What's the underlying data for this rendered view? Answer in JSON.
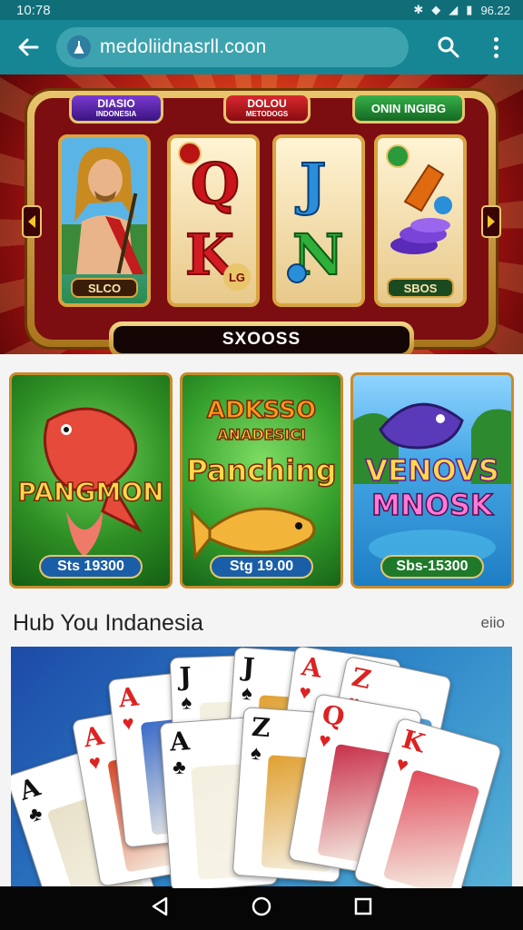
{
  "status_bar": {
    "time": "10:78",
    "battery": "96.22",
    "colors": {
      "background": "#0f6e78"
    }
  },
  "toolbar": {
    "url": "medoliidnasrll.coon",
    "back_icon": "back-arrow-icon",
    "search_icon": "search-icon",
    "menu_icon": "more-vert-icon",
    "colors": {
      "background": "#168694",
      "url_bar": "#3da3af"
    }
  },
  "banner": {
    "pill_left_line1": "DIASIO",
    "pill_left_line2": "INDONESIA",
    "pill_mid_line1": "DOLOU",
    "pill_mid_line2": "METODOGS",
    "pill_right": "ONIN INGIBG",
    "reels": [
      {
        "label": "SLCO"
      },
      {
        "letter_top": "Q",
        "letter_bottom": "K",
        "badge": "LG"
      },
      {
        "letter_top": "J",
        "letter_bottom": "N"
      },
      {
        "label": "SBOS"
      }
    ],
    "bottom_text": "SXOOSS"
  },
  "games": [
    {
      "title": "PANGMON",
      "price": "Sts 19300"
    },
    {
      "title_top": "ADKSSO",
      "title_mid": "ANADESICI",
      "title": "Panching",
      "price": "Stg 19.00"
    },
    {
      "title_top": "VENOVS",
      "title": "MNOSK",
      "price": "Sbs-15300"
    }
  ],
  "section": {
    "title": "Hub You Indanesia",
    "link": "eiio"
  },
  "cards": [
    {
      "rank": "A",
      "suit": "♣",
      "color": "blk"
    },
    {
      "rank": "A",
      "suit": "♥",
      "color": "red"
    },
    {
      "rank": "A",
      "suit": "♥",
      "color": "red"
    },
    {
      "rank": "J",
      "suit": "♠",
      "color": "blk"
    },
    {
      "rank": "J",
      "suit": "♠",
      "color": "blk"
    },
    {
      "rank": "A",
      "suit": "♥",
      "color": "red"
    },
    {
      "rank": "Z",
      "suit": "♥",
      "color": "red"
    },
    {
      "rank": "A",
      "suit": "♣",
      "color": "blk"
    },
    {
      "rank": "Z",
      "suit": "♠",
      "color": "blk"
    },
    {
      "rank": "Q",
      "suit": "♥",
      "color": "red"
    },
    {
      "rank": "K",
      "suit": "♥",
      "color": "red"
    }
  ],
  "nav_bar": {
    "back_icon": "nav-back-icon",
    "home_icon": "nav-home-icon",
    "recents_icon": "nav-recents-icon"
  }
}
